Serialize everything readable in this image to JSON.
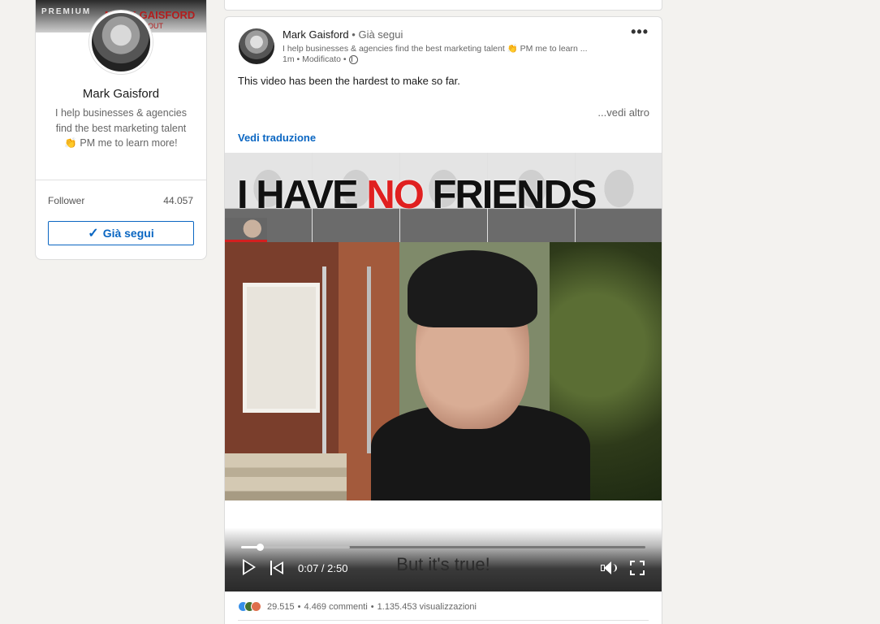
{
  "sidebar": {
    "banner_premium": "PREMIUM",
    "banner_name": "MARK GAISFORD",
    "banner_sub": "BOUT",
    "name": "Mark Gaisford",
    "headline": "I help businesses & agencies find the best marketing talent 👏 PM me to learn more!",
    "follower_label": "Follower",
    "follower_count": "44.057",
    "follow_button": "Già segui",
    "check_icon": "✓"
  },
  "post": {
    "author_name": "Mark Gaisford",
    "separator": "•",
    "follow_state": "Già segui",
    "author_headline": "I help businesses & agencies find the best marketing talent 👏 PM me to learn ...",
    "meta": "1m • Modificato •",
    "more_icon": "•••",
    "text": "This video has been the hardest to make so far.",
    "see_more": "...vedi altro",
    "translate": "Vedi traduzione",
    "video": {
      "title_part1": "I HAVE ",
      "title_red": "NO",
      "title_part2": " FRIENDS",
      "caption": "But it's true!",
      "time": "0:07 / 2:50",
      "progress_played": 0.047,
      "progress_buffered": 0.27
    },
    "stats": {
      "reactions": "29.515",
      "comments": "4.469 commenti",
      "views": "1.135.453 visualizzazioni",
      "dot": "•"
    }
  },
  "colors": {
    "accent": "#0a66c2",
    "background": "#f3f2ef",
    "headline_red": "#e02020"
  }
}
